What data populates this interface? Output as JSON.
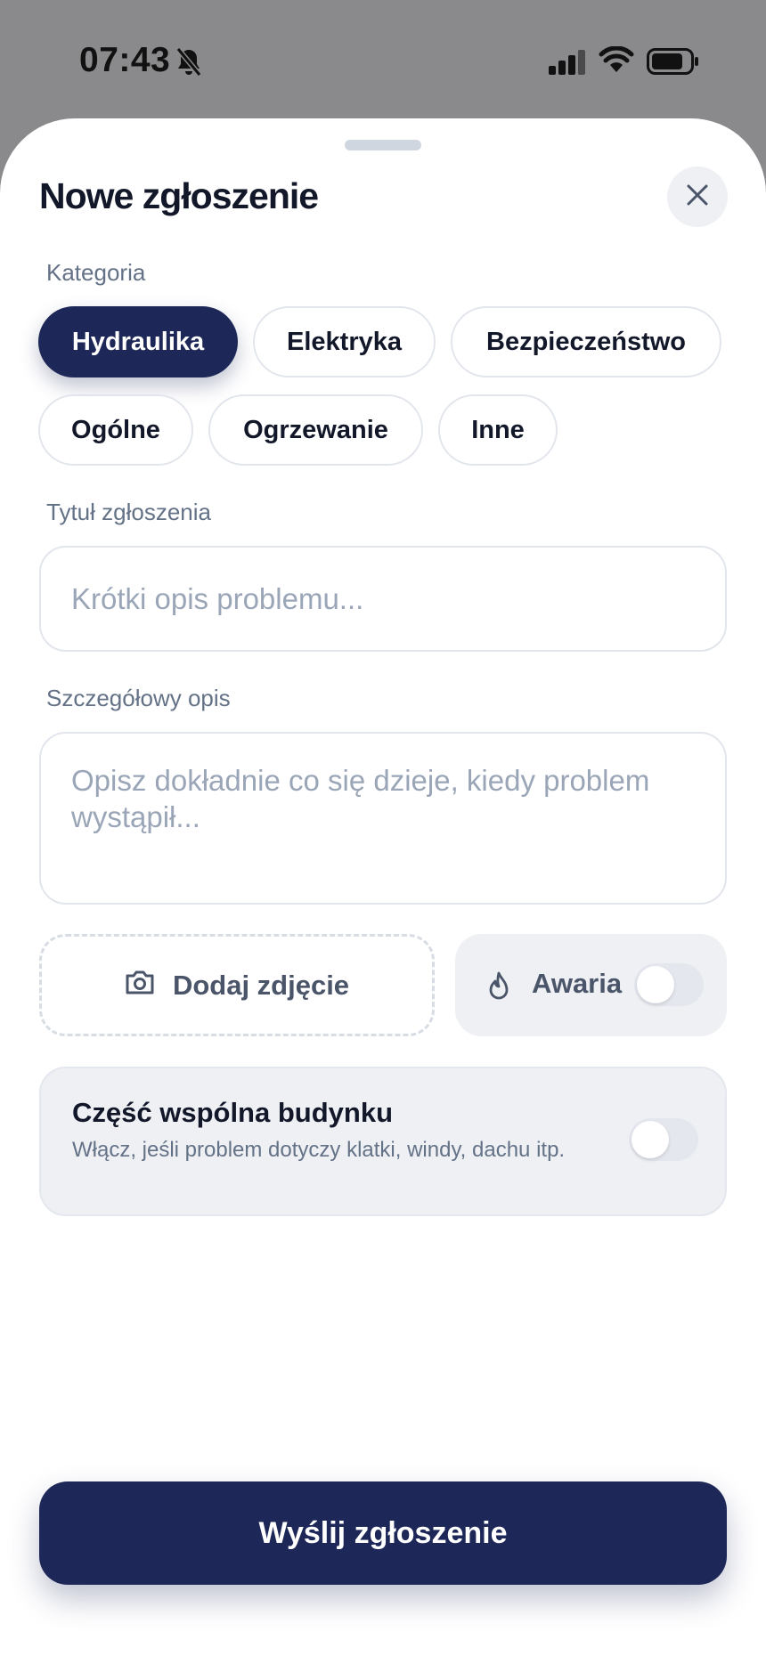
{
  "status_bar": {
    "time": "07:43",
    "icons": [
      "bell-slash-icon",
      "signal-icon",
      "wifi-icon",
      "battery-icon"
    ]
  },
  "sheet": {
    "title": "Nowe zgłoszenie",
    "close_icon": "close-icon"
  },
  "category": {
    "label": "Kategoria",
    "options": [
      "Hydraulika",
      "Elektryka",
      "Bezpieczeństwo",
      "Ogólne",
      "Ogrzewanie",
      "Inne"
    ],
    "selected": "Hydraulika"
  },
  "title_field": {
    "label": "Tytuł zgłoszenia",
    "value": "",
    "placeholder": "Krótki opis problemu..."
  },
  "description_field": {
    "label": "Szczegółowy opis",
    "value": "",
    "placeholder": "Opisz dokładnie co się dzieje, kiedy problem wystąpił..."
  },
  "photo": {
    "label": "Dodaj zdjęcie",
    "icon": "camera-icon"
  },
  "emergency": {
    "label": "Awaria",
    "icon": "flame-icon",
    "enabled": false
  },
  "common_area": {
    "title": "Część wspólna budynku",
    "description": "Włącz, jeśli problem dotyczy klatki, windy, dachu itp.",
    "enabled": false
  },
  "submit": {
    "label": "Wyślij zgłoszenie"
  },
  "colors": {
    "primary": "#1e2858",
    "muted_text": "#647287",
    "panel_bg": "#eef0f4",
    "border": "#e2e6ec"
  }
}
